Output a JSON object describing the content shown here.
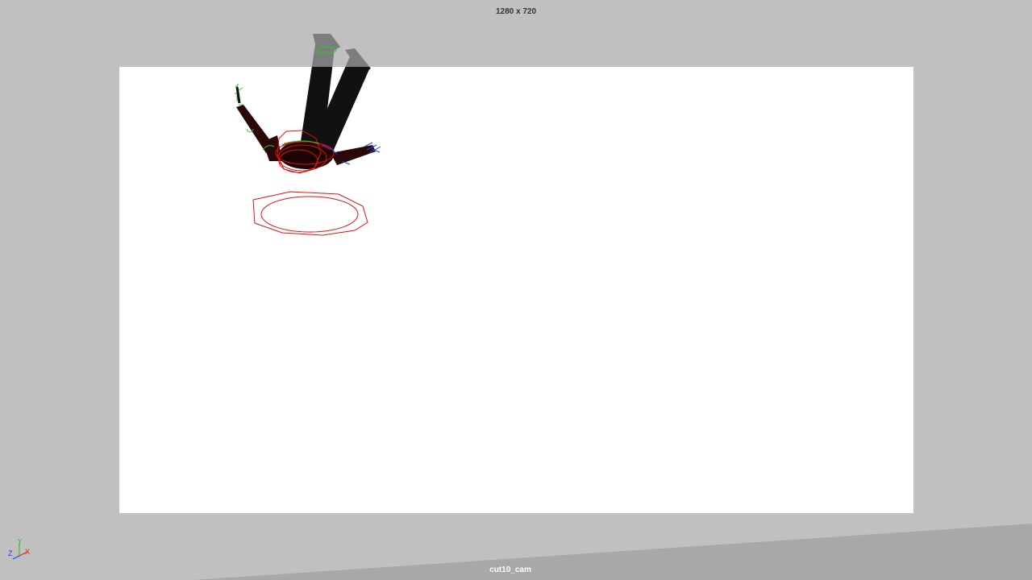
{
  "viewport": {
    "resolution_label": "1280 x 720",
    "camera_name": "cut10_cam",
    "background_color": "#c0c0c0",
    "render_gate_color": "#ffffff"
  },
  "axis_gizmo": {
    "x_label": "X",
    "y_label": "Y",
    "z_label": "Z",
    "x_color": "#e02020",
    "y_color": "#20c020",
    "z_color": "#2040e0"
  },
  "scene": {
    "character_color": "#111111",
    "control_curve_color": "#e01010",
    "secondary_control_color": "#20d020"
  }
}
